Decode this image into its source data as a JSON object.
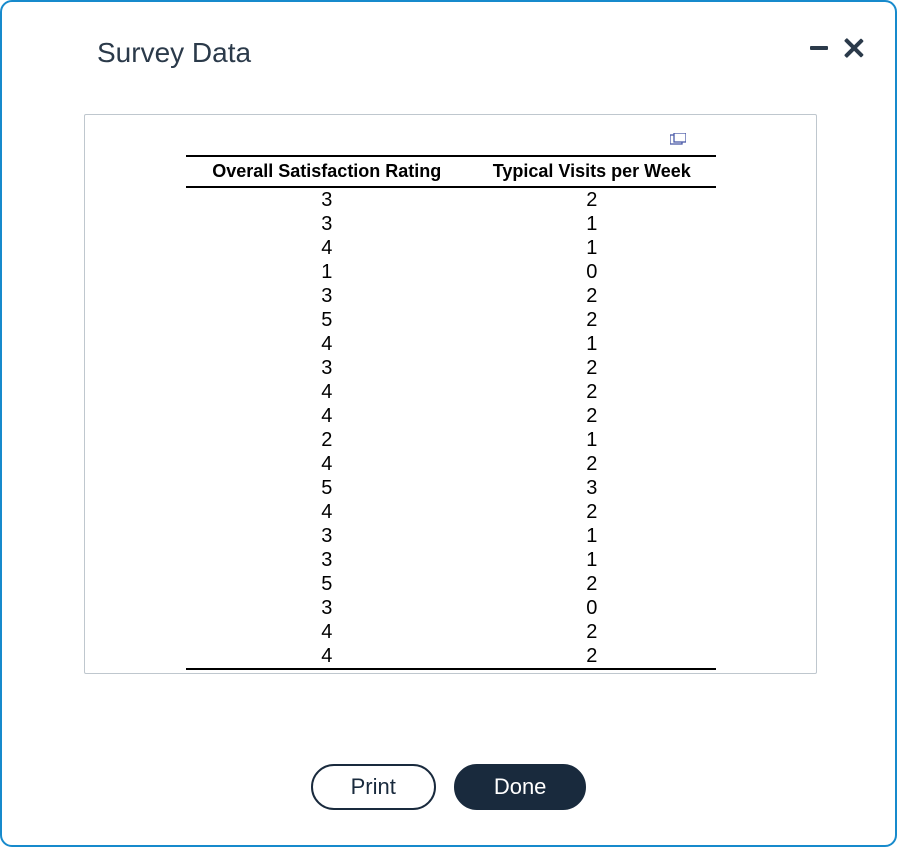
{
  "title": "Survey Data",
  "table": {
    "headers": [
      "Overall Satisfaction Rating",
      "Typical Visits per Week"
    ],
    "rows": [
      [
        3,
        2
      ],
      [
        3,
        1
      ],
      [
        4,
        1
      ],
      [
        1,
        0
      ],
      [
        3,
        2
      ],
      [
        5,
        2
      ],
      [
        4,
        1
      ],
      [
        3,
        2
      ],
      [
        4,
        2
      ],
      [
        4,
        2
      ],
      [
        2,
        1
      ],
      [
        4,
        2
      ],
      [
        5,
        3
      ],
      [
        4,
        2
      ],
      [
        3,
        1
      ],
      [
        3,
        1
      ],
      [
        5,
        2
      ],
      [
        3,
        0
      ],
      [
        4,
        2
      ],
      [
        4,
        2
      ]
    ]
  },
  "buttons": {
    "print": "Print",
    "done": "Done"
  }
}
